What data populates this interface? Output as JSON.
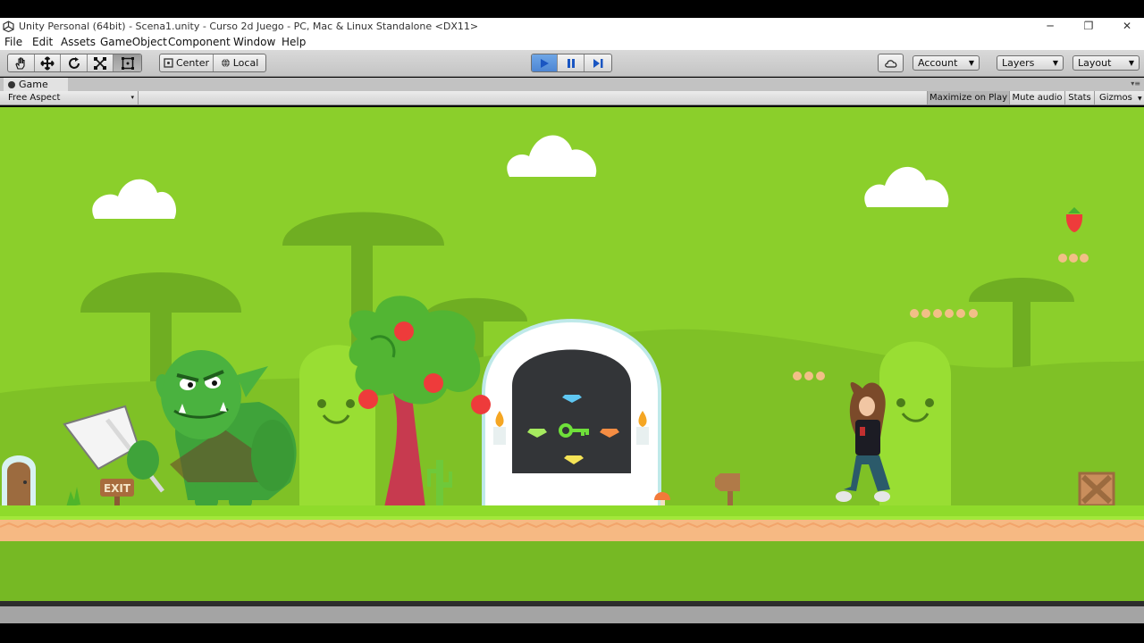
{
  "window": {
    "title": "Unity Personal (64bit) - Scena1.unity - Curso 2d Juego - PC, Mac & Linux Standalone <DX11>",
    "minimize_glyph": "─",
    "maximize_glyph": "❐",
    "close_glyph": "✕"
  },
  "menu": [
    "File",
    "Edit",
    "Assets",
    "GameObject",
    "Component",
    "Window",
    "Help"
  ],
  "toolbar": {
    "pivot_label": "Center",
    "space_label": "Local",
    "account_label": "Account",
    "layers_label": "Layers",
    "layout_label": "Layout",
    "dropdown_arrow": "▼"
  },
  "game_panel": {
    "tab_label": "Game",
    "aspect_label": "Free Aspect",
    "maximize_on_play": "Maximize on Play",
    "mute_audio": "Mute audio",
    "stats": "Stats",
    "gizmos": "Gizmos",
    "gizmos_arrow": "▼"
  },
  "scene": {
    "exit_sign_text": "EXIT",
    "colors": {
      "sky": "#8bcf2b",
      "far_trees": "#6fae22",
      "hills": "#7fc126",
      "grass": "#8fdb2b",
      "dirt": "#f6b983",
      "ground_bottom": "#76b924",
      "coin": "#f2bf87"
    }
  },
  "icons": [
    "unity-logo-icon",
    "hand-tool-icon",
    "move-tool-icon",
    "rotate-tool-icon",
    "scale-tool-icon",
    "rect-tool-icon",
    "pivot-icon",
    "globe-icon",
    "play-icon",
    "pause-icon",
    "step-icon",
    "cloud-icon",
    "game-view-icon"
  ]
}
